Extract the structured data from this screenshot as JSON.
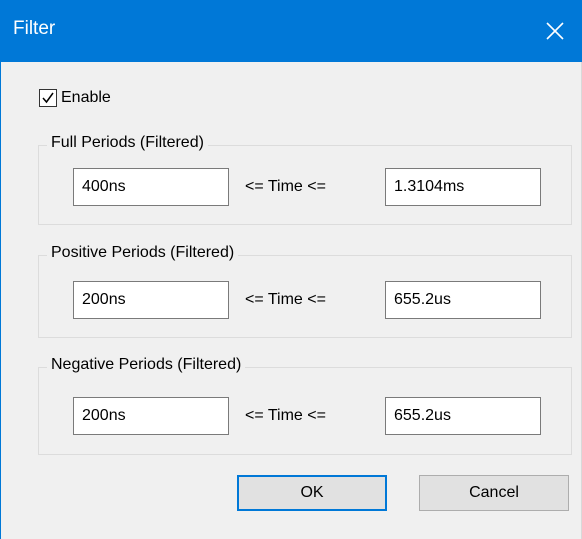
{
  "window": {
    "title": "Filter",
    "accent_color": "#0078d7",
    "close_icon": "close-icon"
  },
  "enable": {
    "label": "Enable",
    "checked": true
  },
  "groups": [
    {
      "title": "Full Periods (Filtered)",
      "min": "400ns",
      "relation": "<= Time <=",
      "max": "1.3104ms"
    },
    {
      "title": "Positive Periods (Filtered)",
      "min": "200ns",
      "relation": "<= Time <=",
      "max": "655.2us"
    },
    {
      "title": "Negative Periods (Filtered)",
      "min": "200ns",
      "relation": "<= Time <=",
      "max": "655.2us"
    }
  ],
  "buttons": {
    "ok_label": "OK",
    "cancel_label": "Cancel"
  }
}
